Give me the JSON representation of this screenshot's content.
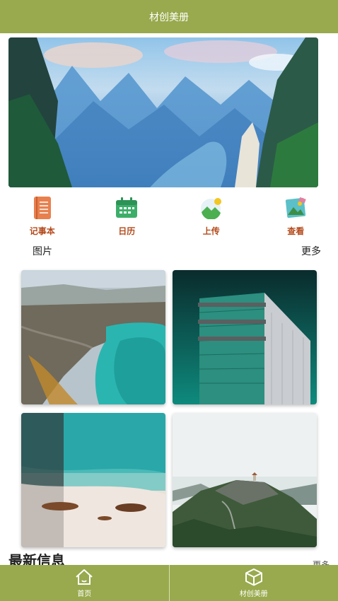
{
  "header": {
    "title": "材创美册"
  },
  "banner": {
    "alt": "mountain landscape banner"
  },
  "quick_links": [
    {
      "label": "记事本",
      "icon": "notebook-icon"
    },
    {
      "label": "日历",
      "icon": "calendar-icon"
    },
    {
      "label": "上传",
      "icon": "upload-icon"
    },
    {
      "label": "查看",
      "icon": "view-icon"
    }
  ],
  "pictures": {
    "title": "图片",
    "more": "更多",
    "items": [
      {
        "name": "coastal-aerial-photo"
      },
      {
        "name": "glass-tower-photo"
      },
      {
        "name": "beach-boats-photo"
      },
      {
        "name": "mountain-pagoda-photo"
      }
    ]
  },
  "latest": {
    "title": "最新信息",
    "more": "更多"
  },
  "tabbar": {
    "items": [
      {
        "label": "首页",
        "icon": "home-icon"
      },
      {
        "label": "材创美册",
        "icon": "cube-icon"
      }
    ]
  },
  "colors": {
    "brand": "#98aa4d",
    "accent_text": "#b44a1b"
  }
}
